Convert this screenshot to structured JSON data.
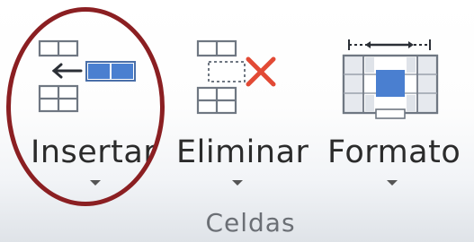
{
  "ribbon_group": {
    "name": "Celdas",
    "commands": [
      {
        "label": "Insertar",
        "icon": "insert-cells-icon",
        "has_dropdown": true
      },
      {
        "label": "Eliminar",
        "icon": "delete-cells-icon",
        "has_dropdown": true
      },
      {
        "label": "Formato",
        "icon": "format-cells-icon",
        "has_dropdown": true
      }
    ]
  },
  "annotation": {
    "type": "ellipse-highlight",
    "target": "Insertar",
    "color": "#8b1f22"
  },
  "colors": {
    "accent_blue": "#4a7fd0",
    "delete_red": "#e24a35"
  }
}
